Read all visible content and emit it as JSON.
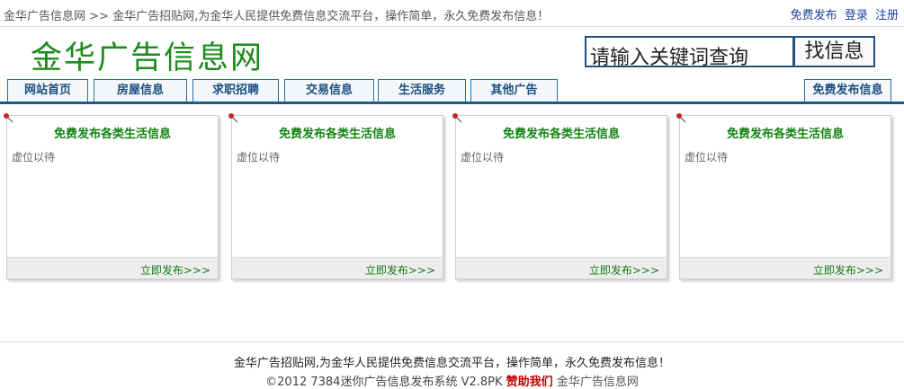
{
  "topbar": {
    "site_name": "金华广告信息网",
    "separator": ">>",
    "tagline": "金华广告招贴网,为金华人民提供免费信息交流平台，操作简单，永久免费发布信息！",
    "links": {
      "publish": "免费发布",
      "login": "登录",
      "register": "注册"
    }
  },
  "header": {
    "logo": "金华广告信息网",
    "search_placeholder": "请输入关键词查询",
    "search_button": "找信息"
  },
  "nav": {
    "tabs": [
      "网站首页",
      "房屋信息",
      "求职招聘",
      "交易信息",
      "生活服务",
      "其他广告"
    ],
    "publish_tab": "免费发布信息"
  },
  "cards": [
    {
      "title": "免费发布各类生活信息",
      "body": "虚位以待",
      "link": "立即发布>>>"
    },
    {
      "title": "免费发布各类生活信息",
      "body": "虚位以待",
      "link": "立即发布>>>"
    },
    {
      "title": "免费发布各类生活信息",
      "body": "虚位以待",
      "link": "立即发布>>>"
    },
    {
      "title": "免费发布各类生活信息",
      "body": "虚位以待",
      "link": "立即发布>>>"
    }
  ],
  "footer": {
    "description": "金华广告招贴网,为金华人民提供免费信息交流平台，操作简单，永久免费发布信息！",
    "copyright": "©2012 7384迷你广告信息发布系统 V2.8PK",
    "sponsor": "赞助我们",
    "site": "金华广告信息网"
  },
  "colors": {
    "logo": "#1c8a1c",
    "nav_border": "#2c6b9a",
    "nav_line": "#1a5b8c",
    "card_title": "#138213",
    "sponsor": "#c40000",
    "top_links": "#1e3f9c"
  },
  "icons": {
    "card_pin": "pushpin-icon"
  }
}
